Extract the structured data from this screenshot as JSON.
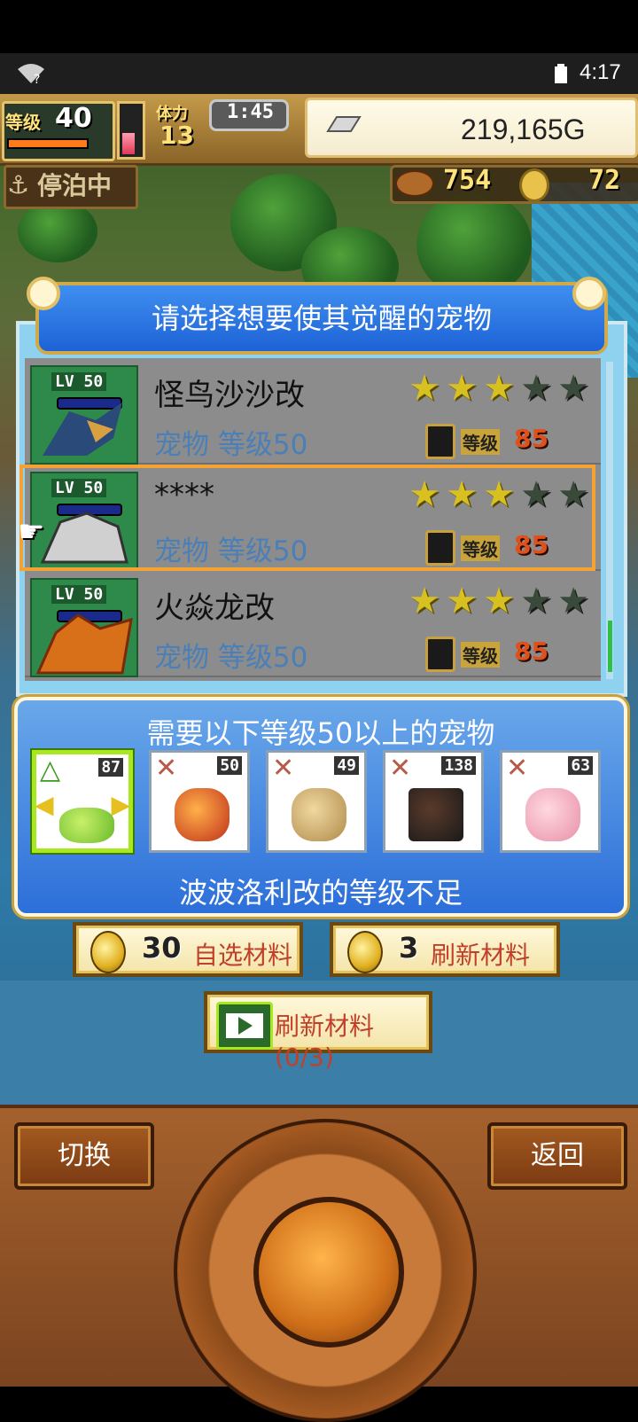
{
  "status_bar": {
    "time": "4:17",
    "wifi_icon": "wifi-question-icon",
    "battery_icon": "battery-icon"
  },
  "hud": {
    "level_label": "等级",
    "level_value": "40",
    "crew_label": "体力",
    "crew_value": "13",
    "timer": "1:45",
    "gold": "219,165G",
    "anchor_label": "停泊中",
    "food": "754",
    "medals": "72"
  },
  "dialog": {
    "title": "请选择想要使其觉醒的宠物",
    "pets": [
      {
        "name": "怪鸟沙沙改",
        "sub": "宠物 等级50",
        "lv_tag": "LV 50",
        "stars_on": 3,
        "stars_total": 5,
        "lock_label": "等级",
        "lock_level": "85"
      },
      {
        "name": "****",
        "sub": "宠物 等级50",
        "lv_tag": "LV 50",
        "stars_on": 3,
        "stars_total": 5,
        "lock_label": "等级",
        "lock_level": "85"
      },
      {
        "name": "火焱龙改",
        "sub": "宠物 等级50",
        "lv_tag": "LV 50",
        "stars_on": 3,
        "stars_total": 5,
        "lock_label": "等级",
        "lock_level": "85"
      }
    ]
  },
  "requirement": {
    "title": "需要以下等级50以上的宠物",
    "footer": "波波洛利改的等级不足",
    "cards": [
      {
        "level": "87",
        "mark": "△",
        "selected": true
      },
      {
        "level": "50",
        "mark": "✕",
        "selected": false
      },
      {
        "level": "49",
        "mark": "✕",
        "selected": false
      },
      {
        "level": "138",
        "mark": "✕",
        "selected": false
      },
      {
        "level": "63",
        "mark": "✕",
        "selected": false
      }
    ]
  },
  "buttons": {
    "choose_cost": "30",
    "choose_label": "自选材料",
    "refresh_cost": "3",
    "refresh_label": "刷新材料",
    "video_label": "刷新材料(0/3)",
    "switch_label": "切换",
    "back_label": "返回"
  },
  "colors": {
    "accent_orange": "#f5a234",
    "dialog_blue": "#1d62d6",
    "lock_red": "#e0501a",
    "star_gold": "#d8c020"
  }
}
